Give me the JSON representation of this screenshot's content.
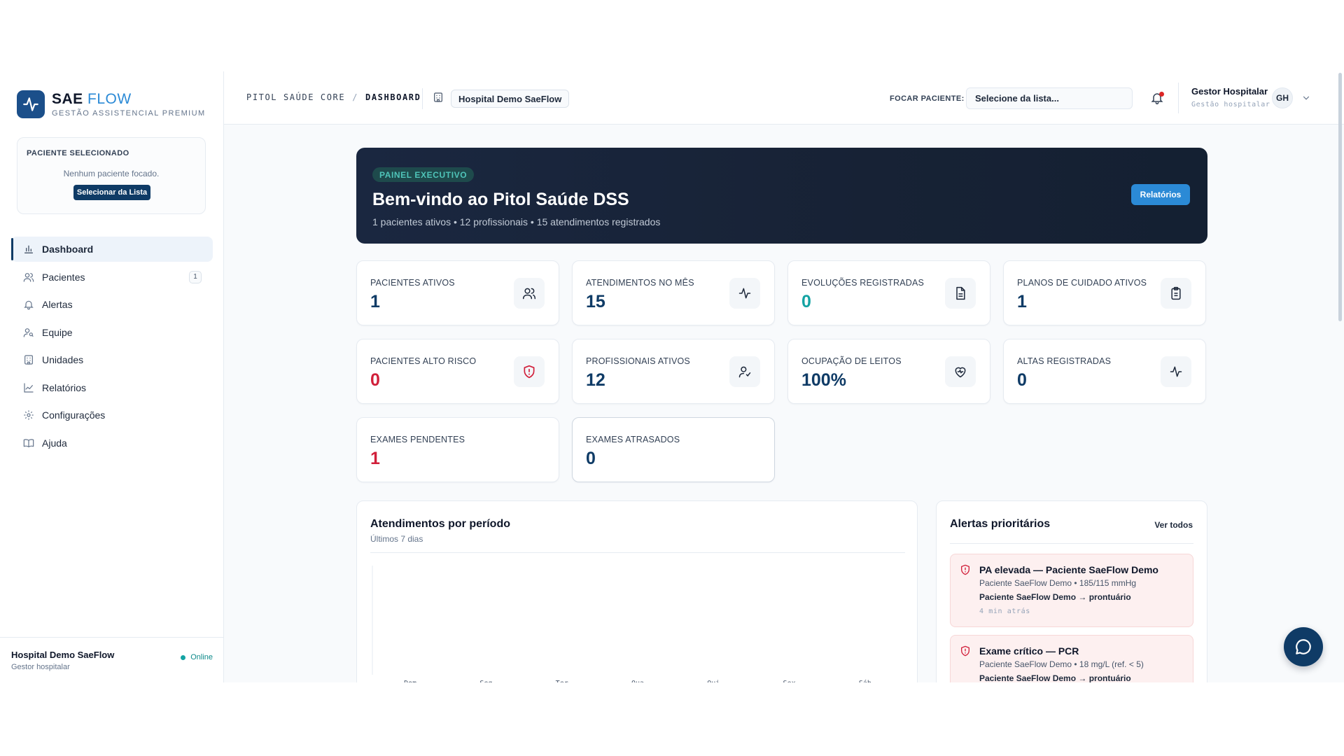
{
  "brand": {
    "name_part1": "SAE",
    "name_part2": "FLOW",
    "tagline": "GESTÃO ASSISTENCIAL PREMIUM",
    "accent": "#2b8ad6",
    "primary": "#0f3b66"
  },
  "selected_patient": {
    "label": "PACIENTE SELECIONADO",
    "empty_text": "Nenhum paciente focado.",
    "button_label": "Selecionar da Lista"
  },
  "sidebar": {
    "items": [
      {
        "label": "Dashboard",
        "icon": "bar-chart-icon",
        "active": true
      },
      {
        "label": "Pacientes",
        "icon": "users-icon",
        "badge": "1"
      },
      {
        "label": "Alertas",
        "icon": "bell-icon"
      },
      {
        "label": "Equipe",
        "icon": "user-group-icon"
      },
      {
        "label": "Unidades",
        "icon": "building-icon"
      },
      {
        "label": "Relatórios",
        "icon": "line-chart-icon"
      },
      {
        "label": "Configurações",
        "icon": "gear-icon"
      },
      {
        "label": "Ajuda",
        "icon": "book-icon"
      }
    ],
    "footer": {
      "unit_name": "Hospital Demo SaeFlow",
      "role": "Gestor hospitalar",
      "status": "Online"
    }
  },
  "topbar": {
    "breadcrumb": [
      "PITOL SAÚDE CORE",
      "DASHBOARD"
    ],
    "unit_chip": "Hospital Demo SaeFlow",
    "focus_label": "FOCAR PACIENTE:",
    "focus_placeholder": "Selecione da lista...",
    "user_name": "Gestor Hospitalar",
    "user_role": "Gestão hospitalar",
    "avatar_initials": "GH"
  },
  "hero": {
    "badge": "PAINEL EXECUTIVO",
    "title": "Bem-vindo ao Pitol Saúde DSS",
    "subtitle": "1 pacientes ativos • 12 profissionais • 15 atendimentos registrados",
    "button_label": "Relatórios"
  },
  "kpis": [
    {
      "label": "PACIENTES ATIVOS",
      "value": "1",
      "icon": "users-icon",
      "tone": "navy"
    },
    {
      "label": "ATENDIMENTOS NO MÊS",
      "value": "15",
      "icon": "activity-icon",
      "tone": "navy"
    },
    {
      "label": "EVOLUÇÕES REGISTRADAS",
      "value": "0",
      "icon": "document-icon",
      "tone": "teal"
    },
    {
      "label": "PLANOS DE CUIDADO ATIVOS",
      "value": "1",
      "icon": "clipboard-icon",
      "tone": "navy"
    },
    {
      "label": "PACIENTES ALTO RISCO",
      "value": "0",
      "icon": "shield-alert-icon",
      "tone": "red"
    },
    {
      "label": "PROFISSIONAIS ATIVOS",
      "value": "12",
      "icon": "user-check-icon",
      "tone": "navy"
    },
    {
      "label": "OCUPAÇÃO DE LEITOS",
      "value": "100%",
      "icon": "heart-pulse-icon",
      "tone": "navy"
    },
    {
      "label": "ALTAS REGISTRADAS",
      "value": "0",
      "icon": "activity-icon",
      "tone": "navy"
    },
    {
      "label": "EXAMES PENDENTES",
      "value": "1",
      "tone": "red"
    },
    {
      "label": "EXAMES ATRASADOS",
      "value": "0",
      "tone": "navy"
    }
  ],
  "chart_panel": {
    "title": "Atendimentos por período",
    "subtitle": "Últimos 7 dias"
  },
  "chart_data": {
    "type": "bar",
    "categories": [
      "Dom",
      "Seg",
      "Ter",
      "Qua",
      "Qui",
      "Sex",
      "Sáb"
    ],
    "values": [
      0,
      0,
      0,
      0,
      0,
      0,
      0
    ],
    "title": "Atendimentos por período",
    "subtitle": "Últimos 7 dias",
    "xlabel": "",
    "ylabel": "",
    "grid": false
  },
  "alerts_panel": {
    "title": "Alertas prioritários",
    "see_all": "Ver todos",
    "items": [
      {
        "title": "PA elevada — Paciente SaeFlow Demo",
        "detail": "Paciente SaeFlow Demo • 185/115 mmHg",
        "link": "Paciente SaeFlow Demo → prontuário",
        "time": "4 min atrás"
      },
      {
        "title": "Exame crítico — PCR",
        "detail": "Paciente SaeFlow Demo • 18 mg/L (ref. < 5)",
        "link": "Paciente SaeFlow Demo → prontuário",
        "time": ""
      }
    ]
  },
  "fab": {
    "icon": "chat-icon"
  }
}
